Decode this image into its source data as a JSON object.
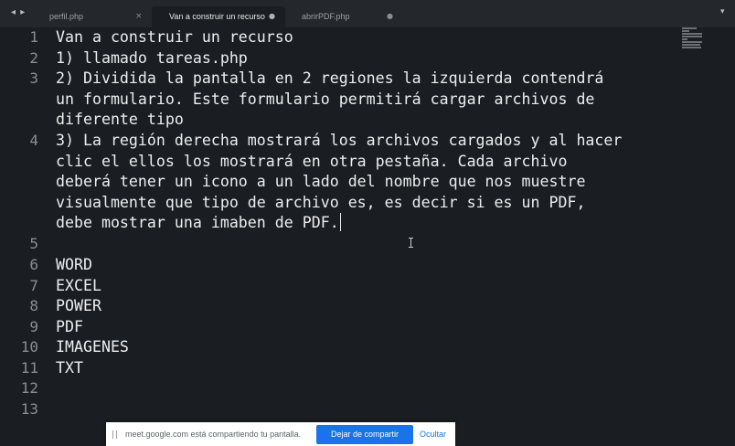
{
  "tabs": [
    {
      "label": "perfil.php",
      "control": "×"
    },
    {
      "label": "Van a construir un recurso",
      "control": "●"
    },
    {
      "label": "abrirPDF.php",
      "control": "●"
    }
  ],
  "nav_arrows": "◂ ▸",
  "dropdown_icon": "▾",
  "editor": {
    "line_numbers": [
      "1",
      "2",
      "3",
      "4",
      "5",
      "6",
      "7",
      "8",
      "9",
      "10",
      "11",
      "12",
      "13"
    ],
    "lines": [
      "Van a construir un recurso",
      "1) llamado tareas.php",
      "2) Dividida la pantalla en 2 regiones la izquierda contendrá",
      "un formulario. Este formulario permitirá cargar archivos de",
      "diferente tipo",
      "3) La región derecha mostrará los archivos cargados y al hacer",
      "clic el ellos los mostrará en otra pestaña. Cada archivo",
      "deberá tener un icono a un lado del nombre que nos muestre",
      "visualmente que tipo de archivo es, es decir si es un PDF,",
      "debe mostrar una imaben de PDF.",
      "",
      "",
      "WORD",
      "EXCEL",
      "POWER",
      "PDF",
      "IMAGENES",
      "TXT",
      "",
      ""
    ]
  },
  "share_bar": {
    "message": "meet.google.com está compartiendo tu pantalla.",
    "stop_label": "Dejar de compartir",
    "hide_label": "Ocultar"
  },
  "colors": {
    "background": "#1a1d21",
    "tab_bar": "#24272b",
    "text": "#eceeef",
    "gutter": "#8a8e93",
    "share_button": "#1a73e8"
  }
}
